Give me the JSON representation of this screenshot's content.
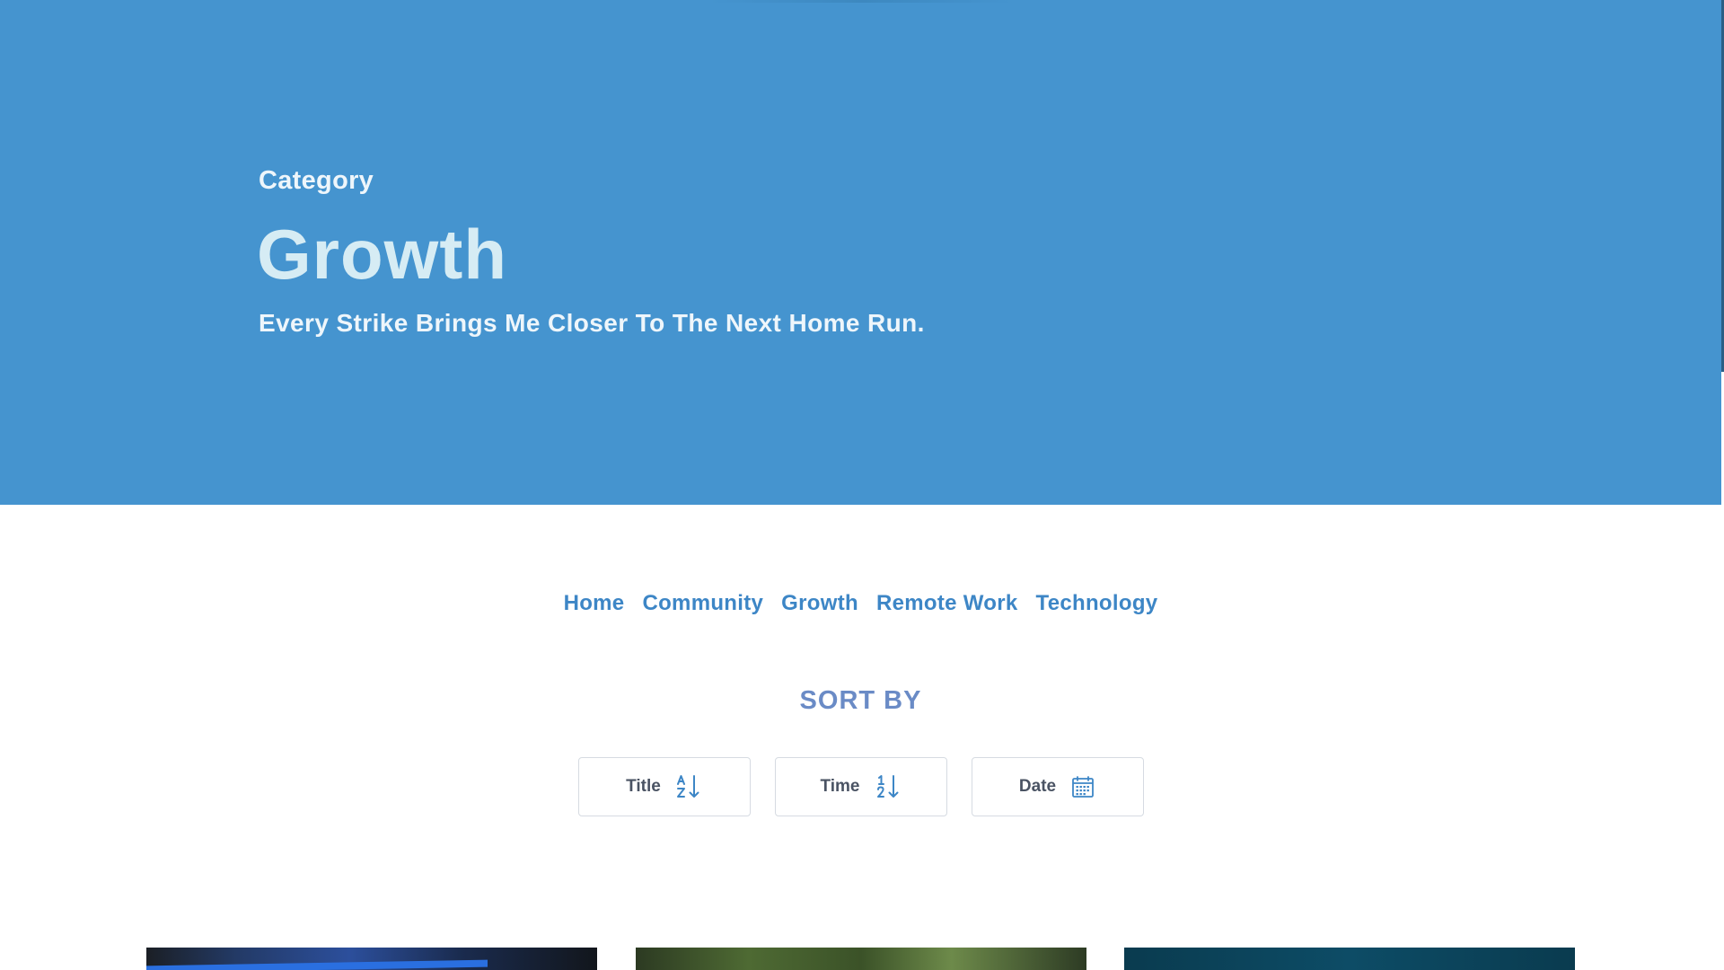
{
  "hero": {
    "eyebrow": "Category",
    "title": "Growth",
    "tagline": "Every Strike Brings Me Closer To The Next Home Run.",
    "background_color": "#4594cf"
  },
  "nav": {
    "items": [
      {
        "label": "Home"
      },
      {
        "label": "Community"
      },
      {
        "label": "Growth"
      },
      {
        "label": "Remote Work"
      },
      {
        "label": "Technology"
      }
    ],
    "link_color": "#3d86c6"
  },
  "sort": {
    "heading": "SORT BY",
    "buttons": [
      {
        "label": "Title",
        "icon": "sort-alpha-down-icon"
      },
      {
        "label": "Time",
        "icon": "sort-numeric-down-icon"
      },
      {
        "label": "Date",
        "icon": "calendar-icon"
      }
    ]
  },
  "cards": [
    {
      "name": "post-card-1"
    },
    {
      "name": "post-card-2"
    },
    {
      "name": "post-card-3"
    }
  ]
}
